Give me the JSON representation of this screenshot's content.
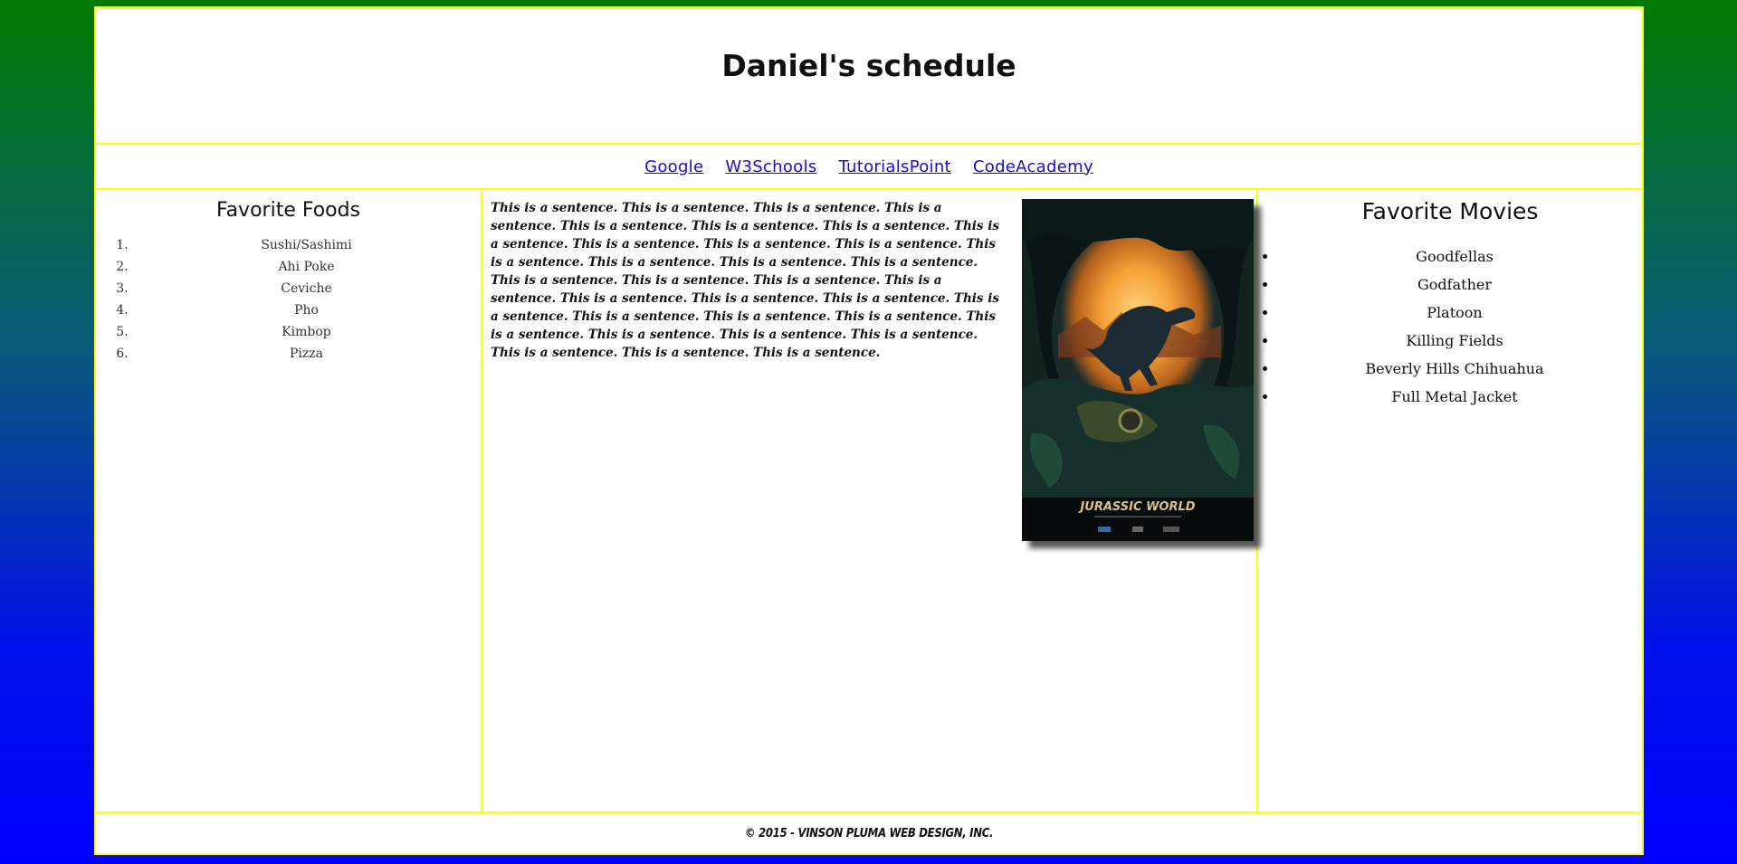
{
  "header": {
    "title": "Daniel's schedule"
  },
  "nav": {
    "links": [
      "Google",
      "W3Schools",
      "TutorialsPoint",
      "CodeAcademy"
    ]
  },
  "foods": {
    "heading": "Favorite Foods",
    "items": [
      "Sushi/Sashimi",
      "Ahi Poke",
      "Ceviche",
      "Pho",
      "Kimbop",
      "Pizza"
    ]
  },
  "content": {
    "paragraph": "This is a sentence. This is a sentence. This is a sentence. This is a sentence. This is a sentence. This is a sentence. This is a sentence. This is a sentence. This is a sentence. This is a sentence. This is a sentence. This is a sentence. This is a sentence. This is a sentence. This is a sentence. This is a sentence. This is a sentence. This is a sentence. This is a sentence. This is a sentence. This is a sentence. This is a sentence. This is a sentence. This is a sentence. This is a sentence. This is a sentence. This is a sentence. This is a sentence. This is a sentence. This is a sentence. This is a sentence. This is a sentence. This is a sentence.",
    "poster_title": "JURASSIC WORLD"
  },
  "movies": {
    "heading": "Favorite Movies",
    "items": [
      "Goodfellas",
      "Godfather",
      "Platoon",
      "Killing Fields",
      "Beverly Hills Chihuahua",
      "Full Metal Jacket"
    ]
  },
  "footer": {
    "text": "© 2015 - VINSON PLUMA WEB DESIGN, INC."
  },
  "colors": {
    "border": "#ffff00",
    "link": "#1a0dcc",
    "bg_top": "#007a00",
    "bg_bottom": "#0000ff"
  }
}
